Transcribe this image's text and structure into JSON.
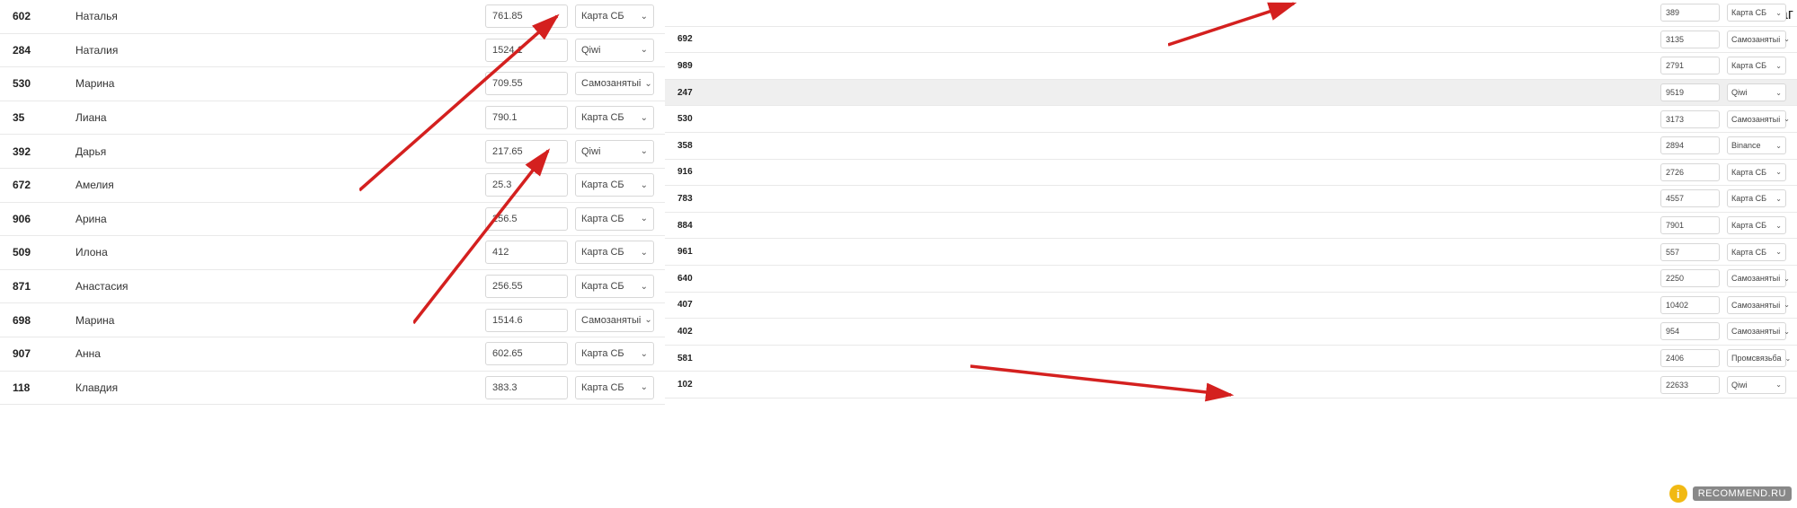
{
  "colors": {
    "arrow": "#d4201f",
    "border": "#e9e9e9"
  },
  "username_tag": "Ольгинаг",
  "watermark": {
    "badge": "i",
    "text": "RECOMMEND.RU"
  },
  "left_rows": [
    {
      "id": "602",
      "name": "Наталья",
      "amount": "761.85",
      "pay": "Карта СБ"
    },
    {
      "id": "284",
      "name": "Наталия",
      "amount": "1524.1",
      "pay": "Qiwi"
    },
    {
      "id": "530",
      "name": "Марина",
      "amount": "709.55",
      "pay": "Самозанятыі"
    },
    {
      "id": "35",
      "name": "Лиана",
      "amount": "790.1",
      "pay": "Карта СБ"
    },
    {
      "id": "392",
      "name": "Дарья",
      "amount": "217.65",
      "pay": "Qiwi"
    },
    {
      "id": "672",
      "name": "Амелия",
      "amount": "25.3",
      "pay": "Карта СБ"
    },
    {
      "id": "906",
      "name": "Арина",
      "amount": "256.5",
      "pay": "Карта СБ"
    },
    {
      "id": "509",
      "name": "Илона",
      "amount": "412",
      "pay": "Карта СБ"
    },
    {
      "id": "871",
      "name": "Анастасия",
      "amount": "256.55",
      "pay": "Карта СБ"
    },
    {
      "id": "698",
      "name": "Марина",
      "amount": "1514.6",
      "pay": "Самозанятыі"
    },
    {
      "id": "907",
      "name": "Анна",
      "amount": "602.65",
      "pay": "Карта СБ"
    },
    {
      "id": "118",
      "name": "Клавдия",
      "amount": "383.3",
      "pay": "Карта СБ"
    }
  ],
  "right_rows": [
    {
      "id": "",
      "amount": "389",
      "pay": "Карта СБ"
    },
    {
      "id": "692",
      "amount": "3135",
      "pay": "Самозанятыі"
    },
    {
      "id": "989",
      "amount": "2791",
      "pay": "Карта СБ"
    },
    {
      "id": "247",
      "amount": "9519",
      "pay": "Qiwi",
      "highlight": true
    },
    {
      "id": "530",
      "amount": "3173",
      "pay": "Самозанятыі"
    },
    {
      "id": "358",
      "amount": "2894",
      "pay": "Binance"
    },
    {
      "id": "916",
      "amount": "2726",
      "pay": "Карта СБ"
    },
    {
      "id": "783",
      "amount": "4557",
      "pay": "Карта СБ"
    },
    {
      "id": "884",
      "amount": "7901",
      "pay": "Карта СБ"
    },
    {
      "id": "961",
      "amount": "557",
      "pay": "Карта СБ"
    },
    {
      "id": "640",
      "amount": "2250",
      "pay": "Самозанятыі"
    },
    {
      "id": "407",
      "amount": "10402",
      "pay": "Самозанятыі"
    },
    {
      "id": "402",
      "amount": "954",
      "pay": "Самозанятыі"
    },
    {
      "id": "581",
      "amount": "2406",
      "pay": "Промсвязьба"
    },
    {
      "id": "102",
      "amount": "22633",
      "pay": "Qiwi"
    }
  ]
}
